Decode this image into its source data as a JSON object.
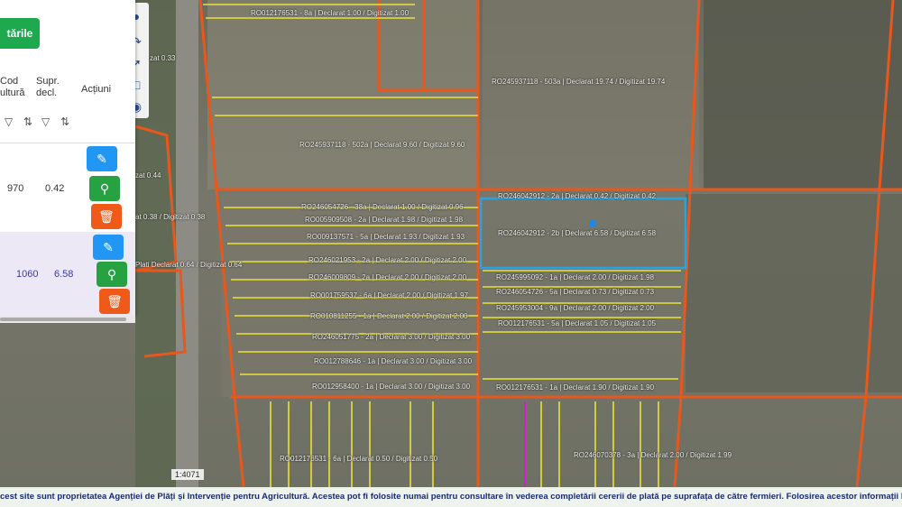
{
  "panel": {
    "submit_label": "tările",
    "columns": {
      "cod": "Cod\nultură",
      "supr": "Supr.\ndecl.",
      "actiuni": "Acțiuni"
    },
    "filter_icons": [
      "filter-icon",
      "sort-icon",
      "filter-icon",
      "sort-icon"
    ],
    "rows": [
      {
        "cod": "970",
        "supr": "0.42",
        "selected": false
      },
      {
        "cod": "1060",
        "supr": "6.58",
        "selected": true
      }
    ]
  },
  "map": {
    "scale": "1:4071",
    "parcels": [
      "RO012176531 - 8a | Declarat 1.00 / Digitizat 1.00",
      "RO245937118 - 503a | Declarat 19.74 / Digitizat 19.74",
      "RO245937118 - 502a | Declarat 9.60 / Digitizat 9.60",
      "RO246054726 - 38a | Declarat 1.00 / Digitizat 0.96",
      "RO005909508 - 2a | Declarat 1.98 / Digitizat 1.98",
      "RO009137571 - 5a | Declarat 1.93 / Digitizat 1.93",
      "RO246021953 - 2a | Declarat 2.00 / Digitizat 2.00",
      "RO246009809 - 2a | Declarat 2.00 / Digitizat 2.00",
      "RO001759537 - 6a | Declarat 2.00 / Digitizat 1.97",
      "RO010811255 - 1a | Declarat 2.00 / Digitizat 2.00",
      "RO246051775 - 2a | Declarat 3.00 / Digitizat 3.00",
      "RO012788646 - 1a | Declarat 3.00 / Digitizat 3.00",
      "RO012958400 - 1a | Declarat 3.00 / Digitizat 3.00",
      "RO246042912 - 2a | Declarat 0.42 / Digitizat 0.42",
      "RO246042912 - 2b | Declarat 6.58 / Digitizat 6.58",
      "RO245995092 - 1a | Declarat 2.00 / Digitizat 1.98",
      "RO246054726 - 5a | Declarat 0.73 / Digitizat 0.73",
      "RO245953004 - 9a | Declarat 2.00 / Digitizat 2.00",
      "RO012176531 - 5a | Declarat 1.05 / Digitizat 1.05",
      "RO012176531 - 1a | Declarat 1.90 / Digitizat 1.90",
      "RO012176531 - 6a | Declarat 0.50 / Digitizat 0.50",
      "RO246070378 - 3a | Declarat 2.00 / Digitizat 1.99"
    ],
    "partial_labels": [
      "zat 0.33",
      "zat 0.44",
      "at 0.38 / Digitizat 0.38",
      "Plati Declarat 0.64 / Digitizat 0.64"
    ],
    "colors": {
      "boundary": "#e8571c",
      "parcel_line": "#e9e23a",
      "selected": "#29a3e0"
    }
  },
  "disclaimer": "cest site sunt proprietatea Agenției de Plăți și Intervenție pentru Agricultură. Acestea pot fi folosite numai pentru consultare în vederea completării cererii de plată pe suprafața de către fermieri. Folosirea acestor informații în alte scopuri intră sub incide"
}
